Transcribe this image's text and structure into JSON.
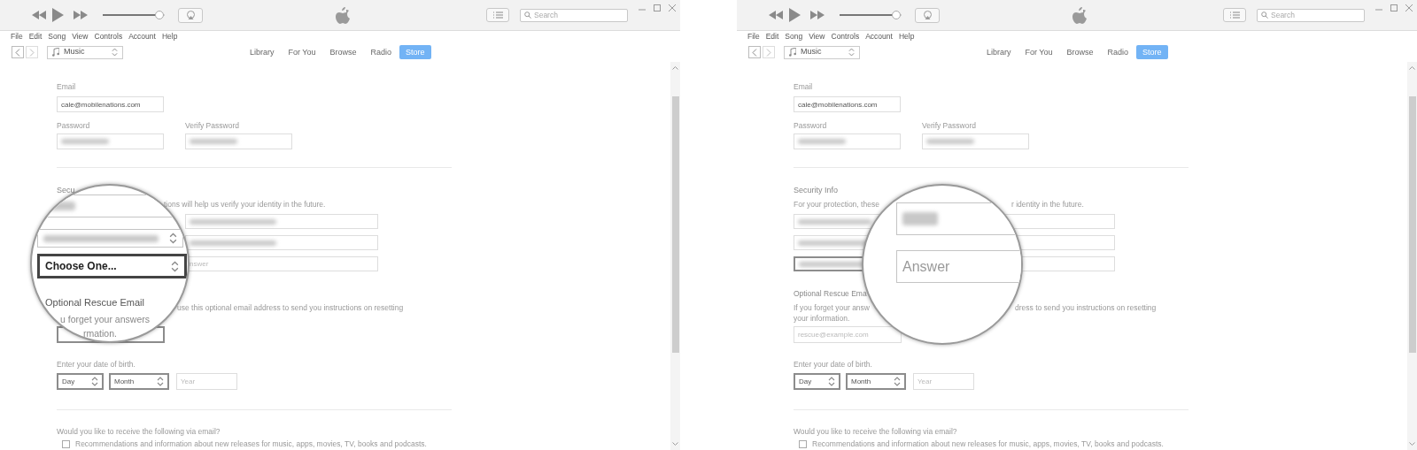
{
  "panels": [
    {
      "player": {
        "volume": {
          "level": 0.92
        }
      },
      "search": {
        "placeholder": "Search"
      },
      "menu": [
        "File",
        "Edit",
        "Song",
        "View",
        "Controls",
        "Account",
        "Help"
      ],
      "media_picker": {
        "value": "Music"
      },
      "tabs": [
        {
          "label": "Library",
          "selected": false
        },
        {
          "label": "For You",
          "selected": false
        },
        {
          "label": "Browse",
          "selected": false
        },
        {
          "label": "Radio",
          "selected": false
        },
        {
          "label": "Store",
          "selected": true
        }
      ],
      "form": {
        "email": {
          "label": "Email",
          "value": "cale@mobilenations.com"
        },
        "password": {
          "label": "Password",
          "redacted": true
        },
        "verify_password": {
          "label": "Verify Password",
          "redacted": true
        },
        "security": {
          "heading": "Secu",
          "description": {
            "after": "tions will help us verify your identity in the future."
          },
          "rows": [
            {
              "answer": {
                "redacted": true
              }
            },
            {
              "answer": {
                "redacted": true
              }
            },
            {
              "answer": {
                "placeholder": "nswer"
              }
            }
          ]
        },
        "rescue": {
          "description": [
            {
              "after": "use this optional email address to send you instructions on resetting"
            }
          ],
          "field": {
            "highlighted": true
          }
        },
        "birth": {
          "label": "Enter your date of birth.",
          "day": {
            "value": "Day",
            "highlighted": true
          },
          "month": {
            "value": "Month",
            "highlighted": true
          },
          "year": {
            "placeholder": "Year"
          }
        },
        "email_prefs": {
          "question": "Would you like to receive the following via email?",
          "options": [
            {
              "label": "Recommendations and information about new releases for music, apps, movies, TV, books and podcasts.",
              "checked": false
            }
          ]
        }
      },
      "magnifier": {
        "items": [
          {
            "kind": "redacted-field"
          },
          {
            "kind": "redacted-select"
          },
          {
            "kind": "select",
            "value": "Choose One...",
            "highlighted": true
          },
          {
            "kind": "heading",
            "text": "Optional Rescue Email"
          },
          {
            "kind": "text",
            "text": "u forget your answers"
          },
          {
            "kind": "text",
            "text": "rmation."
          }
        ]
      }
    },
    {
      "player": {
        "volume": {
          "level": 0.92
        }
      },
      "search": {
        "placeholder": "Search"
      },
      "menu": [
        "File",
        "Edit",
        "Song",
        "View",
        "Controls",
        "Account",
        "Help"
      ],
      "media_picker": {
        "value": "Music"
      },
      "tabs": [
        {
          "label": "Library",
          "selected": false
        },
        {
          "label": "For You",
          "selected": false
        },
        {
          "label": "Browse",
          "selected": false
        },
        {
          "label": "Radio",
          "selected": false
        },
        {
          "label": "Store",
          "selected": true
        }
      ],
      "form": {
        "email": {
          "label": "Email",
          "value": "cale@mobilenations.com"
        },
        "password": {
          "label": "Password",
          "redacted": true
        },
        "verify_password": {
          "label": "Verify Password",
          "redacted": true
        },
        "security": {
          "heading": "Security Info",
          "description": {
            "before": "For your protection, these",
            "after": "r identity in the future."
          },
          "rows": [
            {
              "select": {
                "redacted": true,
                "highlighted": false
              }
            },
            {
              "select": {
                "redacted": true,
                "highlighted": false
              }
            },
            {
              "select": {
                "redacted": true,
                "highlighted": true
              }
            }
          ]
        },
        "rescue": {
          "heading": "Optional Rescue Ema",
          "description": [
            {
              "before": "If you forget your answ",
              "after": "dress to send you instructions on resetting"
            },
            {
              "before": "your information."
            }
          ],
          "field": {
            "placeholder": "rescue@example.com",
            "highlighted": false
          }
        },
        "birth": {
          "label": "Enter your date of birth.",
          "day": {
            "value": "Day",
            "highlighted": true
          },
          "month": {
            "value": "Month",
            "highlighted": true
          },
          "year": {
            "placeholder": "Year"
          }
        },
        "email_prefs": {
          "question": "Would you like to receive the following via email?",
          "options": [
            {
              "label": "Recommendations and information about new releases for music, apps, movies, TV, books and podcasts.",
              "checked": false
            }
          ]
        }
      },
      "magnifier": {
        "items": [
          {
            "kind": "redacted-field"
          },
          {
            "kind": "field",
            "placeholder": "Answer"
          }
        ]
      }
    }
  ]
}
